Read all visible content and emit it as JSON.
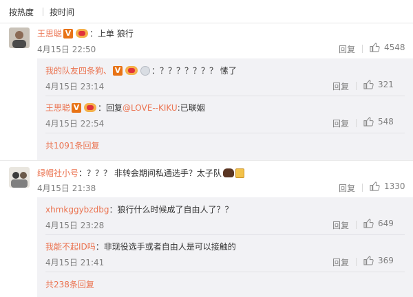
{
  "sort_tabs": {
    "hot_label": "按热度",
    "time_label": "按时间"
  },
  "comments": [
    {
      "username": "王思聪",
      "text": "：上单 狼行",
      "time": "4月15日 22:50",
      "reply_label": "回复",
      "likes": "4548",
      "replies": [
        {
          "username": "我的队友四条狗、",
          "text": "：？？？？？？？ 愫了",
          "time": "4月15日 23:14",
          "reply_label": "回复",
          "likes": "321"
        },
        {
          "username": "王思聪",
          "text_prefix": "：回复",
          "mention": "@LOVE--KIKU",
          "text_suffix": ":已联姻",
          "time": "4月15日 22:54",
          "reply_label": "回复",
          "likes": "548"
        }
      ],
      "more_replies": "共1091条回复"
    },
    {
      "username": "绿帽社小号",
      "text": "：？？？ 非转会期间私通选手？太子队",
      "time": "4月15日 21:38",
      "reply_label": "回复",
      "likes": "1330",
      "replies": [
        {
          "username": "xhmkggybzdbg",
          "text": "：狼行什么时候成了自由人了？？",
          "time": "4月15日 23:28",
          "reply_label": "回复",
          "likes": "649"
        },
        {
          "username": "我能不起ID吗",
          "text": "：非现役选手或者自由人是可以接触的",
          "time": "4月15日 21:41",
          "reply_label": "回复",
          "likes": "369"
        }
      ],
      "more_replies": "共238条回复"
    }
  ],
  "icons": {
    "like": "thumbs-up-icon",
    "verified": "verified-v-badge-icon",
    "vip": "vip-crown-badge-icon",
    "medal": "medal-badge-icon",
    "bear": "bear-emoji-icon",
    "beer": "beer-emoji-icon"
  },
  "colors": {
    "username": "#eb7350",
    "link": "#eb7350",
    "meta": "#808080",
    "reply_box_bg": "#f2f2f5"
  }
}
